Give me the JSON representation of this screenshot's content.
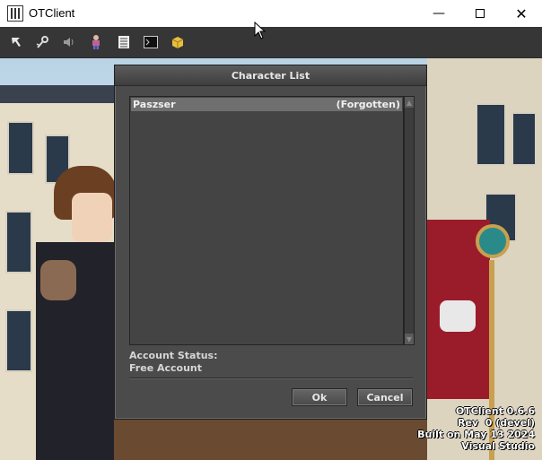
{
  "window": {
    "title": "OTClient",
    "minimize_glyph": "—",
    "close_glyph": "✕"
  },
  "toolbar": {
    "items": [
      {
        "icon": "arrow-cursor-icon"
      },
      {
        "icon": "options-icon"
      },
      {
        "icon": "sound-icon"
      },
      {
        "icon": "character-icon"
      },
      {
        "icon": "notes-icon"
      },
      {
        "icon": "terminal-icon"
      },
      {
        "icon": "module-box-icon"
      }
    ]
  },
  "dialog": {
    "title": "Character List",
    "characters": [
      {
        "name": "Paszser",
        "world": "(Forgotten)"
      }
    ],
    "account_status_label": "Account Status:",
    "account_status_value": "Free Account",
    "ok_label": "Ok",
    "cancel_label": "Cancel"
  },
  "info": {
    "line1": "OTClient 0.6.6",
    "line2": "Rev  0 (devel)",
    "line3": "Built on May 13 2024",
    "line4": "Visual Studio"
  },
  "colors": {
    "toolbar_bg": "#363636",
    "dialog_bg": "#4b4b4b",
    "selected_row": "#6f6f6f"
  }
}
